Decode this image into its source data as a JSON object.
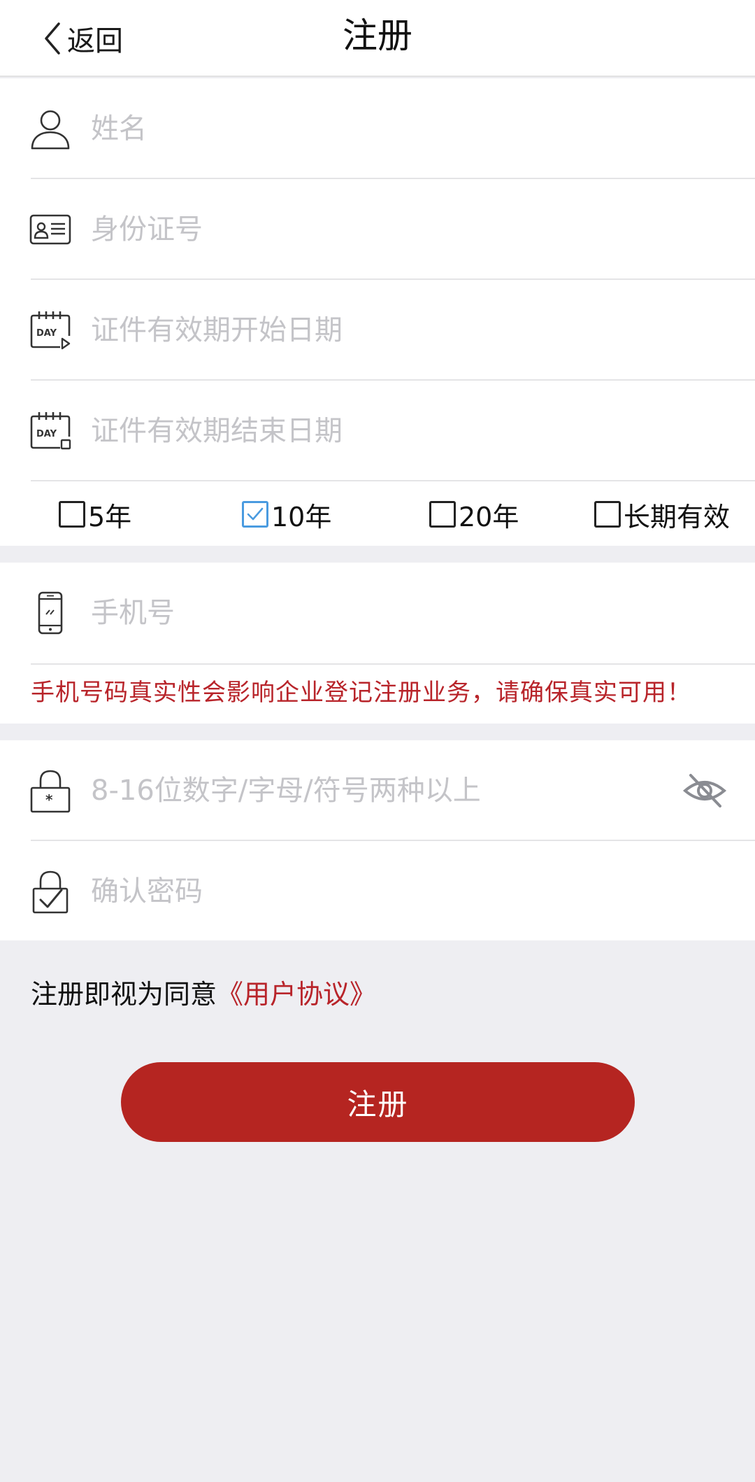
{
  "header": {
    "back_label": "返回",
    "title": "注册"
  },
  "form": {
    "name_placeholder": "姓名",
    "id_placeholder": "身份证号",
    "start_date_placeholder": "证件有效期开始日期",
    "end_date_placeholder": "证件有效期结束日期",
    "terms": [
      {
        "label": "5年",
        "checked": false
      },
      {
        "label": "10年",
        "checked": true
      },
      {
        "label": "20年",
        "checked": false
      },
      {
        "label": "长期有效",
        "checked": false
      }
    ],
    "phone_placeholder": "手机号",
    "phone_warning": "手机号码真实性会影响企业登记注册业务，请确保真实可用！",
    "password_placeholder": "8-16位数字/字母/符号两种以上",
    "confirm_placeholder": "确认密码"
  },
  "agreement": {
    "prefix": "注册即视为同意",
    "link": "《用户协议》"
  },
  "submit_label": "注册",
  "icons": {
    "back": "chevron-left-icon",
    "name": "user-icon",
    "id": "id-card-icon",
    "start_date": "calendar-day-start-icon",
    "end_date": "calendar-day-end-icon",
    "phone": "phone-icon",
    "password": "lock-icon",
    "confirm": "lock-check-icon",
    "visibility": "eye-off-icon"
  },
  "colors": {
    "accent": "#b52521",
    "warning": "#b8242a",
    "checkbox_checked": "#4a9be0",
    "background": "#eeeef2"
  }
}
